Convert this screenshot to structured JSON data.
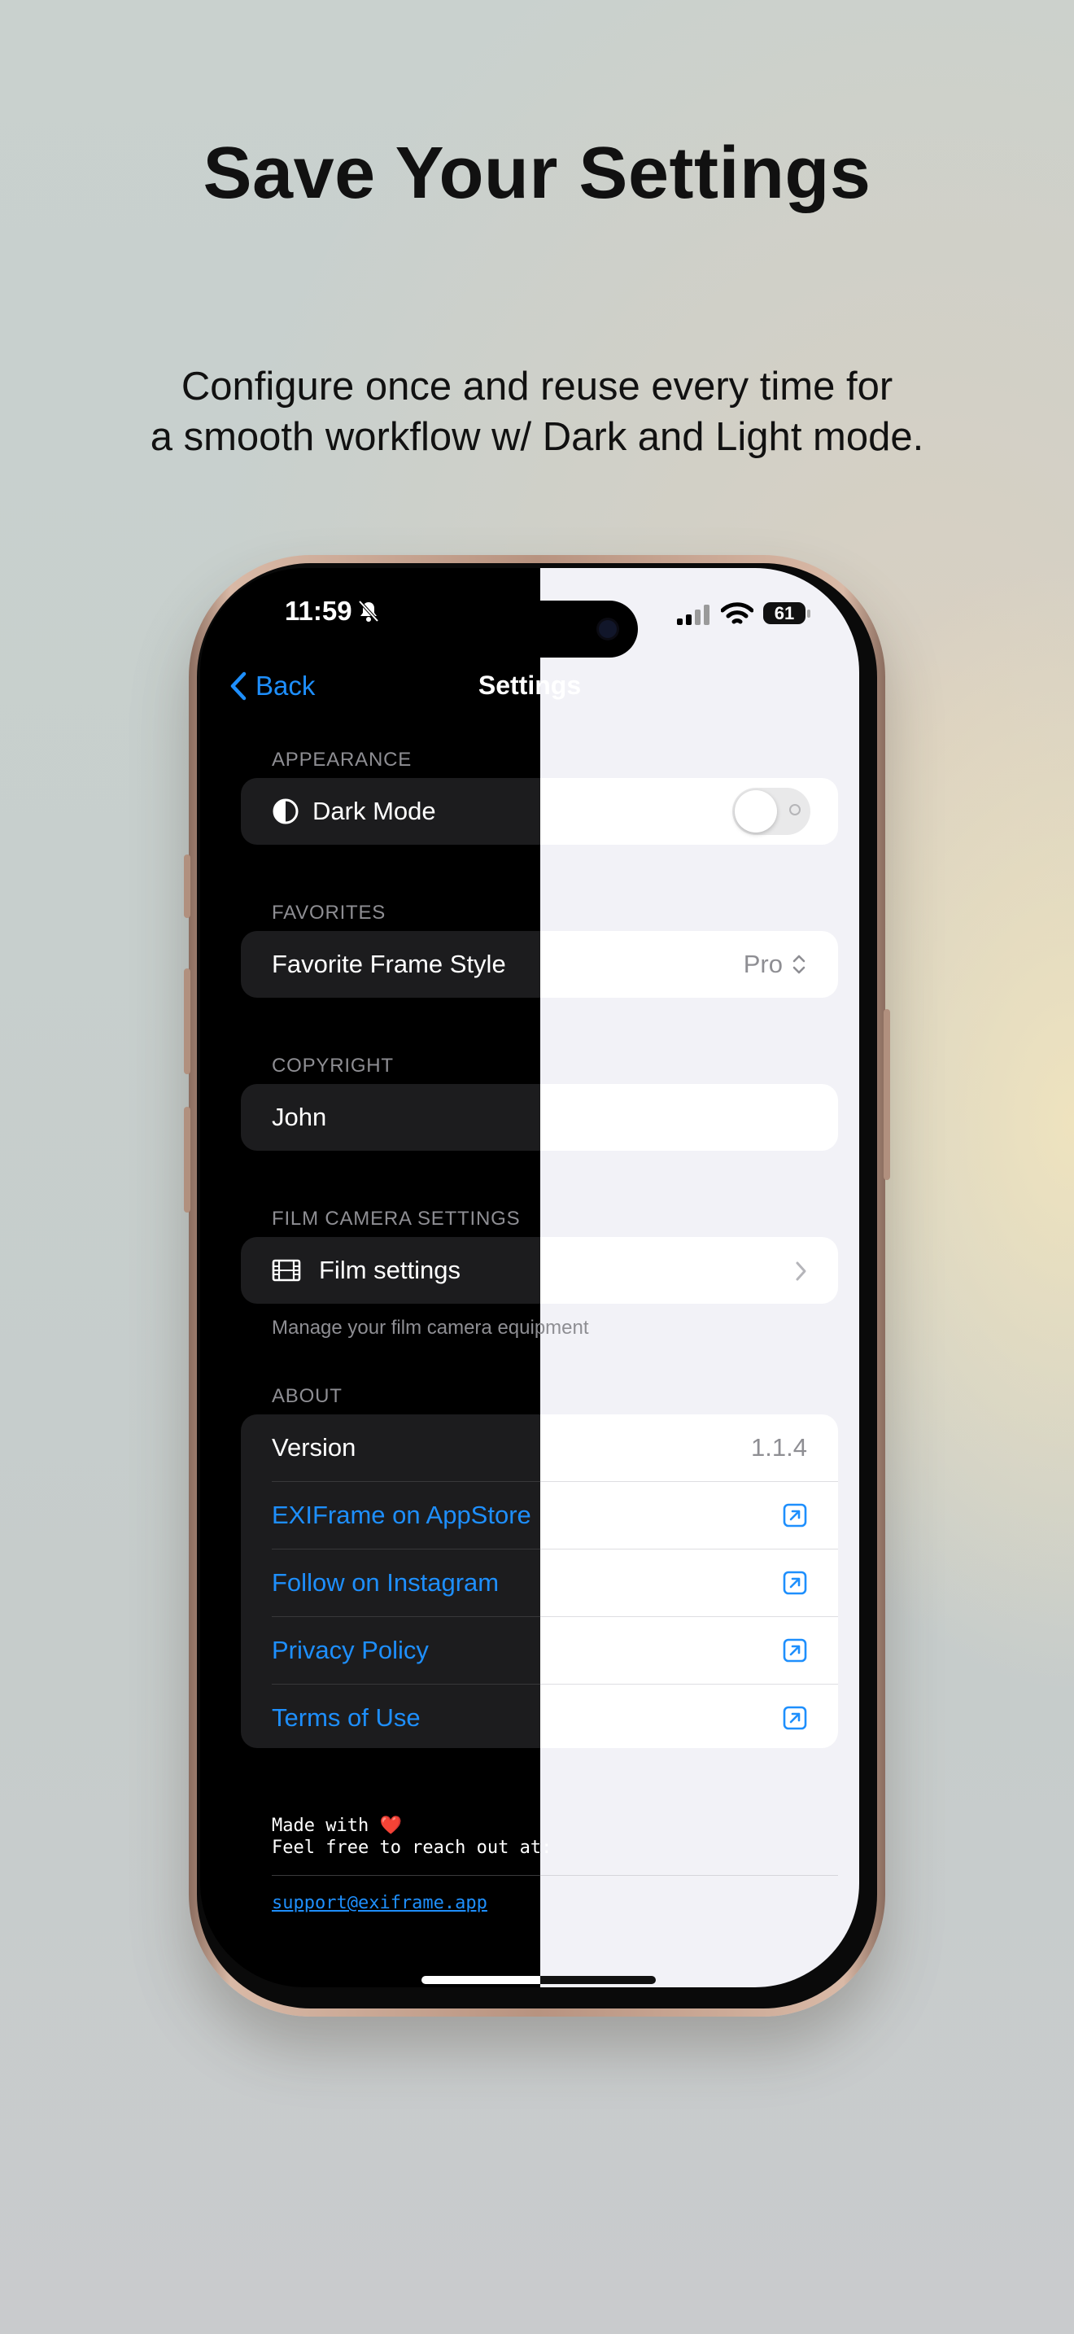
{
  "headline": "Save Your Settings",
  "subtitle": {
    "line1": "Configure once and reuse every time for",
    "line2": "a smooth workflow w/ Dark and Light mode."
  },
  "status_bar": {
    "time": "11:59",
    "battery": "61"
  },
  "nav": {
    "back_label": "Back",
    "title": "Settings"
  },
  "sections": {
    "appearance": {
      "title": "APPEARANCE",
      "dark_mode_label": "Dark Mode",
      "dark_mode_on": false
    },
    "favorites": {
      "title": "FAVORITES",
      "frame_style_label": "Favorite Frame Style",
      "frame_style_value": "Pro"
    },
    "copyright": {
      "title": "COPYRIGHT",
      "name_value": "John"
    },
    "film": {
      "title": "FILM CAMERA SETTINGS",
      "settings_label": "Film settings",
      "footnote": "Manage your film camera equipment"
    },
    "about": {
      "title": "ABOUT",
      "version_label": "Version",
      "version_value": "1.1.4",
      "links": [
        "EXIFrame on AppStore",
        "Follow on Instagram",
        "Privacy Policy",
        "Terms of Use"
      ]
    }
  },
  "footer": {
    "made_with": "Made with ",
    "heart": "❤️",
    "reach_out": "Feel free to reach out at:",
    "email": "support@exiframe.app"
  },
  "colors": {
    "accent_blue": "#1e8ffd",
    "dark_bg": "#000000",
    "dark_card": "#1c1c1e",
    "light_bg": "#f2f2f7",
    "light_card": "#ffffff"
  }
}
